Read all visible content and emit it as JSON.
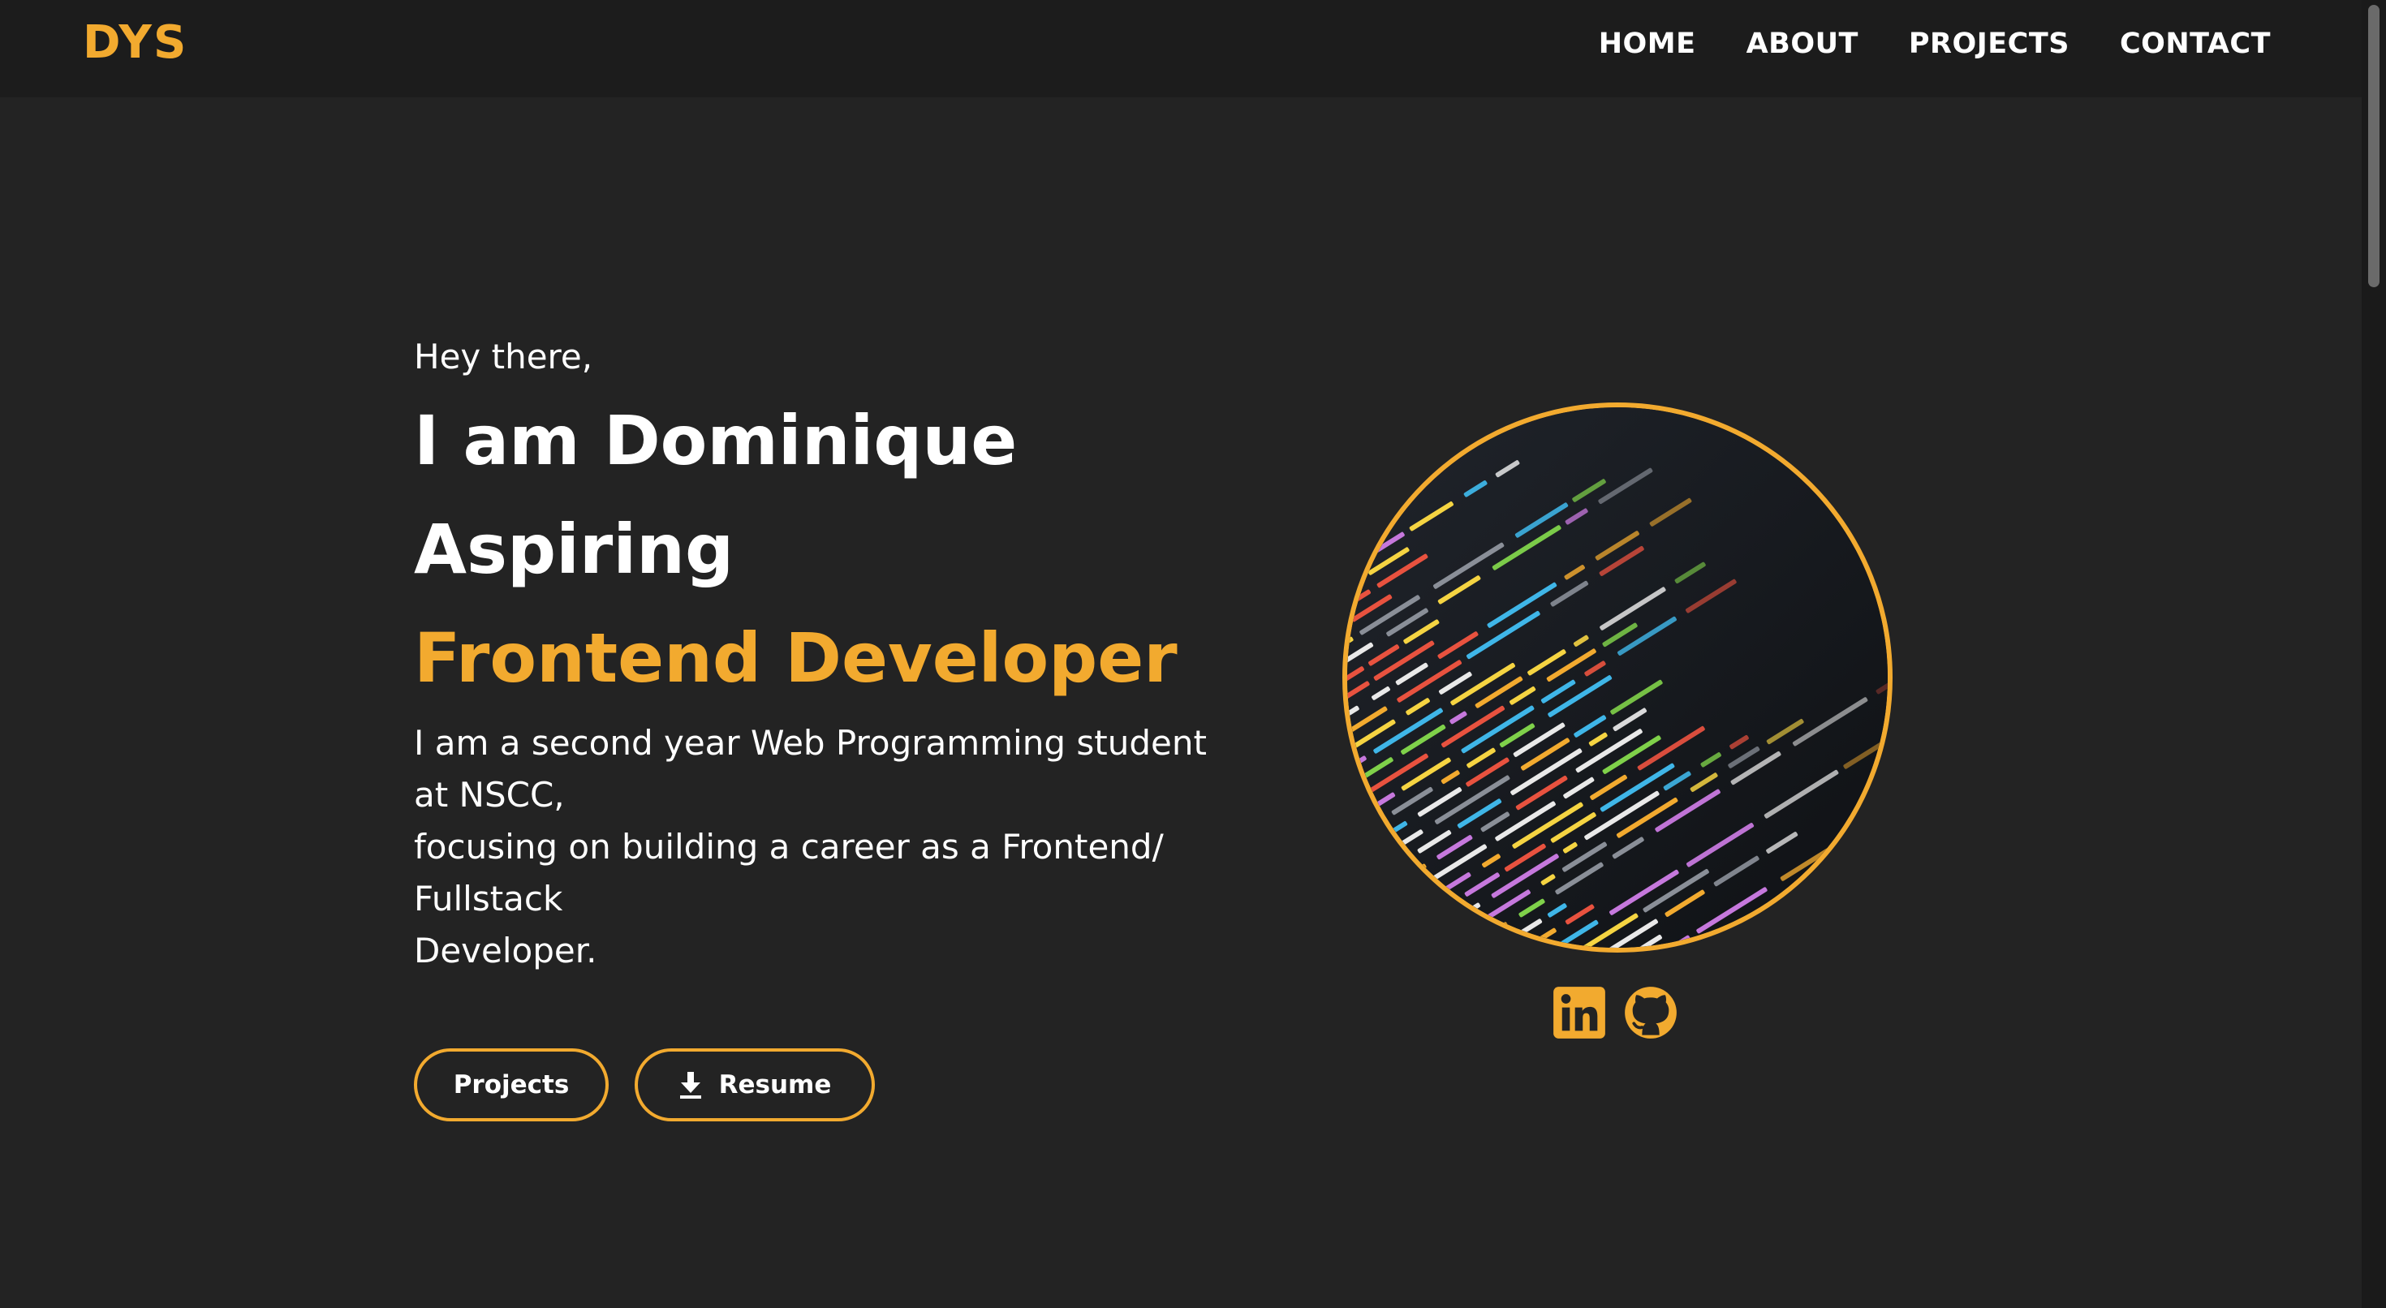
{
  "nav": {
    "logo": "DYS",
    "links": [
      "HOME",
      "ABOUT",
      "PROJECTS",
      "CONTACT"
    ]
  },
  "hero": {
    "greeting": "Hey there,",
    "name_line": "I am Dominique",
    "aspiring": "Aspiring",
    "role": "Frontend Developer",
    "bio_lines": [
      "I am a second year Web Programming student",
      "at NSCC,",
      "focusing on building a career as a Frontend/",
      "Fullstack",
      "Developer."
    ],
    "buttons": {
      "projects": "Projects",
      "resume": "Resume"
    },
    "image_icon": "code-screenshot-image"
  },
  "socials": [
    "linkedin-icon",
    "github-icon"
  ],
  "colors": {
    "accent": "#f2aa2f",
    "background": "#232323",
    "navbar": "#1c1c1c",
    "text": "#ffffff"
  }
}
